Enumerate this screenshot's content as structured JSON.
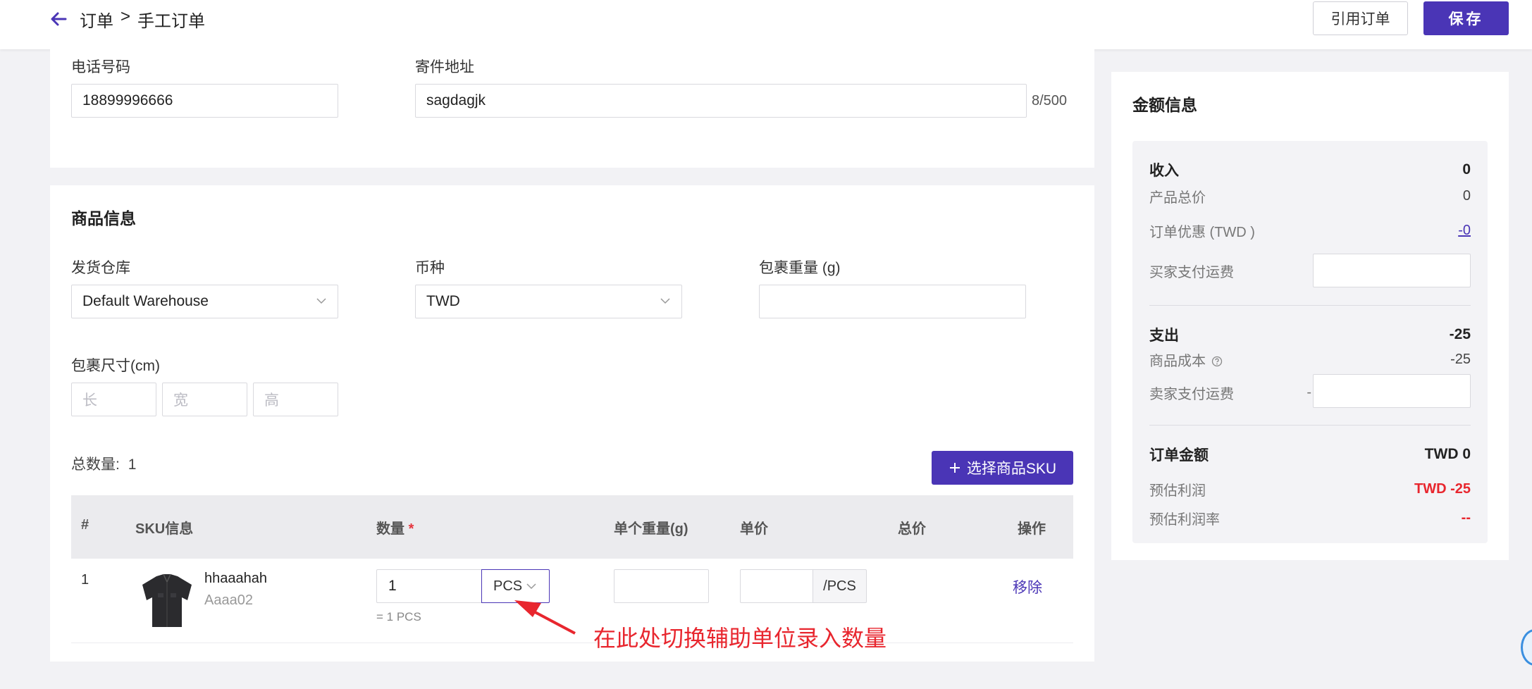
{
  "header": {
    "breadcrumb_1": "订单",
    "breadcrumb_sep": ">",
    "breadcrumb_2": "手工订单",
    "ref_order_label": "引用订单",
    "save_label": "保存"
  },
  "contact": {
    "phone_label": "电话号码",
    "phone_value": "18899996666",
    "address_label": "寄件地址",
    "address_value": "sagdagjk",
    "address_counter": "8/500"
  },
  "goods": {
    "title": "商品信息",
    "warehouse_label": "发货仓库",
    "warehouse_value": "Default Warehouse",
    "currency_label": "币种",
    "currency_value": "TWD",
    "weight_label": "包裹重量 (g)",
    "weight_value": "",
    "dim_label": "包裹尺寸(cm)",
    "dim_length_placeholder": "长",
    "dim_width_placeholder": "宽",
    "dim_height_placeholder": "高",
    "total_qty_label": "总数量:",
    "total_qty_value": "1",
    "select_sku_label": "选择商品SKU"
  },
  "table": {
    "headers": {
      "index": "#",
      "sku": "SKU信息",
      "qty": "数量",
      "qty_required": "*",
      "unit_weight": "单个重量(g)",
      "unit_price": "单价",
      "total_price": "总价",
      "action": "操作"
    },
    "rows": [
      {
        "index": "1",
        "name": "hhaaahah",
        "sku_code": "Aaaa02",
        "qty": "1",
        "unit": "PCS",
        "qty_hint": "= 1 PCS",
        "unit_weight": "",
        "unit_price": "",
        "price_suffix": "/PCS",
        "total": "",
        "remove_label": "移除"
      }
    ]
  },
  "annotation": {
    "text": "在此处切换辅助单位录入数量",
    "color": "#e8262e"
  },
  "money": {
    "title": "金额信息",
    "income_label": "收入",
    "income_value": "0",
    "product_total_label": "产品总价",
    "product_total_value": "0",
    "discount_label": "订单优惠 (TWD )",
    "discount_value": "-0",
    "buyer_shipping_label": "买家支付运费",
    "expense_label": "支出",
    "expense_value": "-25",
    "cost_label": "商品成本",
    "cost_value": "-25",
    "seller_shipping_label": "卖家支付运费",
    "seller_shipping_prefix": "-",
    "order_amount_label": "订单金额",
    "order_amount_value": "TWD 0",
    "est_profit_label": "预估利润",
    "est_profit_value": "TWD -25",
    "est_margin_label": "预估利润率",
    "est_margin_value": "--"
  },
  "colors": {
    "brand": "#4a35b6",
    "danger": "#e8262e"
  }
}
